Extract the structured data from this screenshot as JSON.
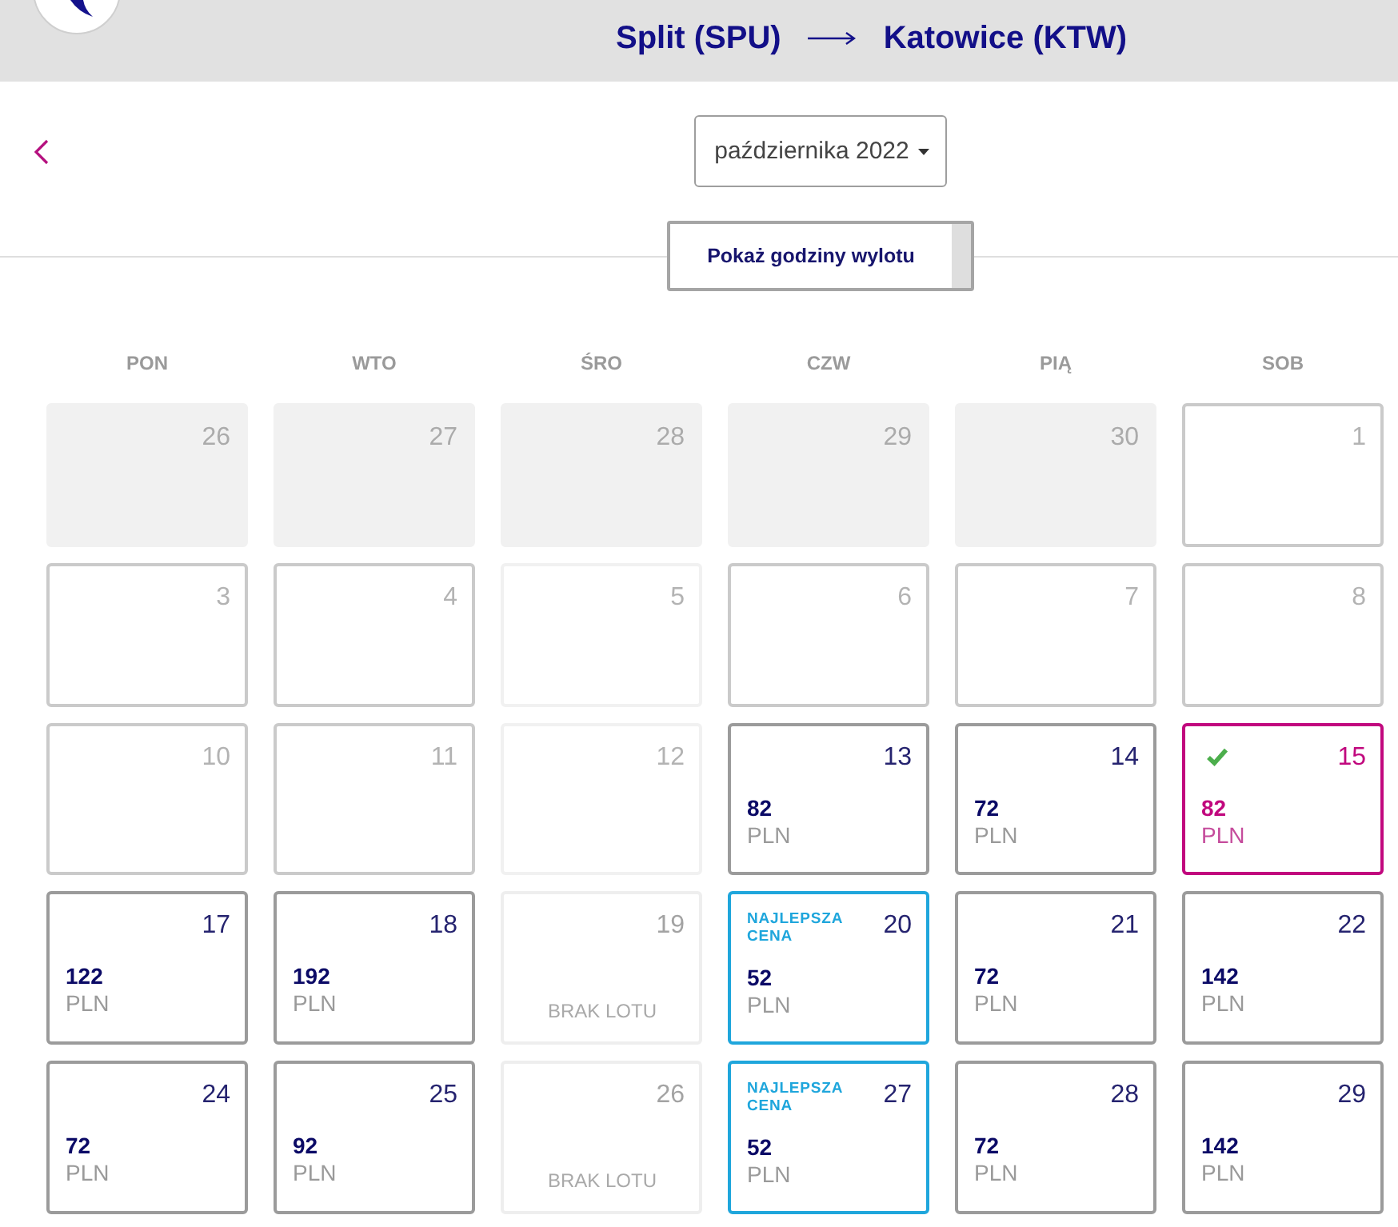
{
  "header": {
    "route_from": "Split (SPU)",
    "route_to": "Katowice (KTW)"
  },
  "month_selector": {
    "value": "października 2022"
  },
  "toggle_button": {
    "label": "Pokaż godziny wylotu"
  },
  "calendar": {
    "weekdays": [
      "PON",
      "WTO",
      "ŚRO",
      "CZW",
      "PIĄ",
      "SOB"
    ],
    "weeks": [
      [
        {
          "day": "26",
          "kind": "outside",
          "selected": false
        },
        {
          "day": "27",
          "kind": "outside",
          "selected": false
        },
        {
          "day": "28",
          "kind": "outside",
          "selected": false
        },
        {
          "day": "29",
          "kind": "outside",
          "selected": false
        },
        {
          "day": "30",
          "kind": "outside",
          "selected": false
        },
        {
          "day": "1",
          "kind": "empty",
          "selected": false
        }
      ],
      [
        {
          "day": "3",
          "kind": "empty",
          "selected": false
        },
        {
          "day": "4",
          "kind": "empty",
          "selected": false
        },
        {
          "day": "5",
          "kind": "blocked",
          "selected": false
        },
        {
          "day": "6",
          "kind": "empty",
          "selected": false
        },
        {
          "day": "7",
          "kind": "empty",
          "selected": false
        },
        {
          "day": "8",
          "kind": "empty",
          "selected": false
        }
      ],
      [
        {
          "day": "10",
          "kind": "empty",
          "selected": false
        },
        {
          "day": "11",
          "kind": "empty",
          "selected": false
        },
        {
          "day": "12",
          "kind": "blocked",
          "selected": false
        },
        {
          "day": "13",
          "kind": "price",
          "price": "82",
          "currency": "PLN",
          "selected": false
        },
        {
          "day": "14",
          "kind": "price",
          "price": "72",
          "currency": "PLN",
          "selected": false
        },
        {
          "day": "15",
          "kind": "price",
          "price": "82",
          "currency": "PLN",
          "selected": true
        }
      ],
      [
        {
          "day": "17",
          "kind": "price",
          "price": "122",
          "currency": "PLN",
          "selected": false
        },
        {
          "day": "18",
          "kind": "price",
          "price": "192",
          "currency": "PLN",
          "selected": false
        },
        {
          "day": "19",
          "kind": "no_flight",
          "note": "BRAK LOTU",
          "selected": false
        },
        {
          "day": "20",
          "kind": "best_price",
          "badge": "NAJLEPSZA CENA",
          "price": "52",
          "currency": "PLN",
          "selected": false
        },
        {
          "day": "21",
          "kind": "price",
          "price": "72",
          "currency": "PLN",
          "selected": false
        },
        {
          "day": "22",
          "kind": "price",
          "price": "142",
          "currency": "PLN",
          "selected": false
        }
      ],
      [
        {
          "day": "24",
          "kind": "price",
          "price": "72",
          "currency": "PLN",
          "selected": false
        },
        {
          "day": "25",
          "kind": "price",
          "price": "92",
          "currency": "PLN",
          "selected": false
        },
        {
          "day": "26",
          "kind": "no_flight",
          "note": "BRAK LOTU",
          "selected": false
        },
        {
          "day": "27",
          "kind": "best_price",
          "badge": "NAJLEPSZA CENA",
          "price": "52",
          "currency": "PLN",
          "selected": false
        },
        {
          "day": "28",
          "kind": "price",
          "price": "72",
          "currency": "PLN",
          "selected": false
        },
        {
          "day": "29",
          "kind": "price",
          "price": "142",
          "currency": "PLN",
          "selected": false
        }
      ]
    ]
  }
}
